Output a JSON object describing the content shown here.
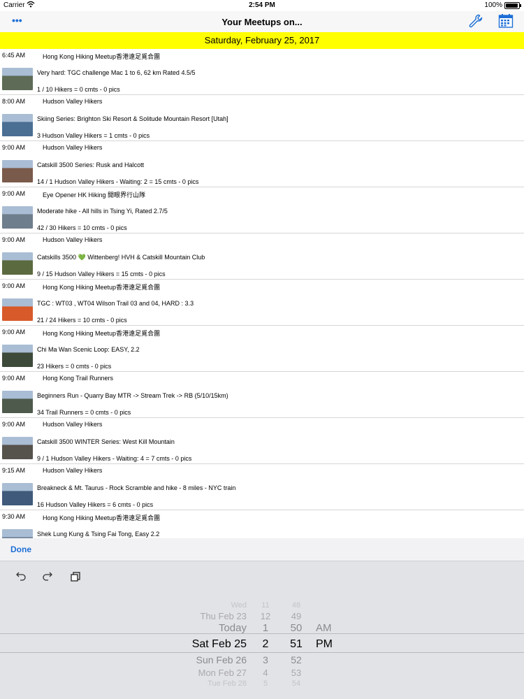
{
  "status": {
    "carrier": "Carrier",
    "time": "2:54 PM",
    "battery": "100%"
  },
  "nav": {
    "title": "Your Meetups on...",
    "more": "•••",
    "wrench_icon": "wrench-icon",
    "calendar_icon": "calendar-icon"
  },
  "date_header": "Saturday, February 25, 2017",
  "meetups": [
    {
      "time": "6:45 AM",
      "group": "Hong Kong Hiking Meetup香港遠足覓合團",
      "desc": "Very hard: TGC challenge Mac 1 to 6, 62 km Rated 4.5/5",
      "stats": "1 / 10 Hikers = 0 cmts - 0 pics",
      "thumb_color": "#5d6b57"
    },
    {
      "time": "8:00 AM",
      "group": "Hudson Valley Hikers",
      "desc": "Skiing Series: Brighton Ski Resort & Solitude Mountain Resort [Utah]",
      "stats": "3 Hudson Valley Hikers = 1 cmts - 0 pics",
      "thumb_color": "#4b6e93"
    },
    {
      "time": "9:00 AM",
      "group": "Hudson Valley Hikers",
      "desc": "Catskill 3500 Series: Rusk and Halcott",
      "stats": "14 / 1 Hudson Valley Hikers - Waiting: 2 = 15 cmts - 0 pics",
      "thumb_color": "#7a5a4a"
    },
    {
      "time": "9:00 AM",
      "group": "Eye Opener HK Hiking 開眼界行山隊",
      "desc": "Moderate hike - All hills in Tsing Yi, Rated 2.7/5",
      "stats": "42 / 30 Hikers = 10 cmts - 0 pics",
      "thumb_color": "#6f7e8c"
    },
    {
      "time": "9:00 AM",
      "group": "Hudson Valley Hikers",
      "desc": "Catskills 3500 💚  Wittenberg! HVH & Catskill Mountain Club",
      "stats": "9 / 15 Hudson Valley Hikers = 15 cmts - 0 pics",
      "thumb_color": "#5c6a3f"
    },
    {
      "time": "9:00 AM",
      "group": "Hong Kong Hiking Meetup香港遠足覓合團",
      "desc": "TGC : WT03 , WT04 Wilson Trail 03 and 04, HARD : 3.3",
      "stats": "21 / 24 Hikers = 10 cmts - 0 pics",
      "thumb_color": "#d85a2a"
    },
    {
      "time": "9:00 AM",
      "group": "Hong Kong Hiking Meetup香港遠足覓合團",
      "desc": "Chi Ma Wan Scenic Loop: EASY, 2.2",
      "stats": "23 Hikers = 0 cmts - 0 pics",
      "thumb_color": "#3d4a3a"
    },
    {
      "time": "9:00 AM",
      "group": "Hong Kong Trail Runners",
      "desc": "Beginners Run - Quarry Bay MTR -> Stream Trek -> RB (5/10/15km)",
      "stats": "34 Trail Runners = 0 cmts - 0 pics",
      "thumb_color": "#4e5a4c"
    },
    {
      "time": "9:00 AM",
      "group": "Hudson Valley Hikers",
      "desc": "Catskill 3500 WINTER Series: West Kill Mountain",
      "stats": "9 / 1 Hudson Valley Hikers - Waiting: 4 = 7 cmts - 0 pics",
      "thumb_color": "#56524c"
    },
    {
      "time": "9:15 AM",
      "group": "Hudson Valley Hikers",
      "desc": "Breakneck & Mt. Taurus - Rock Scramble and hike - 8 miles - NYC train",
      "stats": "16 Hudson Valley Hikers = 6 cmts - 0 pics",
      "thumb_color": "#3f5a7a"
    },
    {
      "time": "9:30 AM",
      "group": "Hong Kong Hiking Meetup香港遠足覓合團",
      "desc": "Shek Lung Kung & Tsing Fai Tong, Easy 2.2",
      "stats": "",
      "thumb_color": "#6b7f95"
    }
  ],
  "picker": {
    "done": "Done",
    "undo_icon": "undo-icon",
    "redo_icon": "redo-icon",
    "paste_icon": "paste-icon",
    "dates": [
      "Wed",
      "Thu Feb 23",
      "Today",
      "Sat Feb 25",
      "Sun Feb 26",
      "Mon Feb 27",
      "Tue Feb 28"
    ],
    "hours": [
      "11",
      "12",
      "1",
      "2",
      "3",
      "4",
      "5"
    ],
    "minutes": [
      "48",
      "49",
      "50",
      "51",
      "52",
      "53",
      "54"
    ],
    "ampm": [
      "AM",
      "PM"
    ]
  }
}
